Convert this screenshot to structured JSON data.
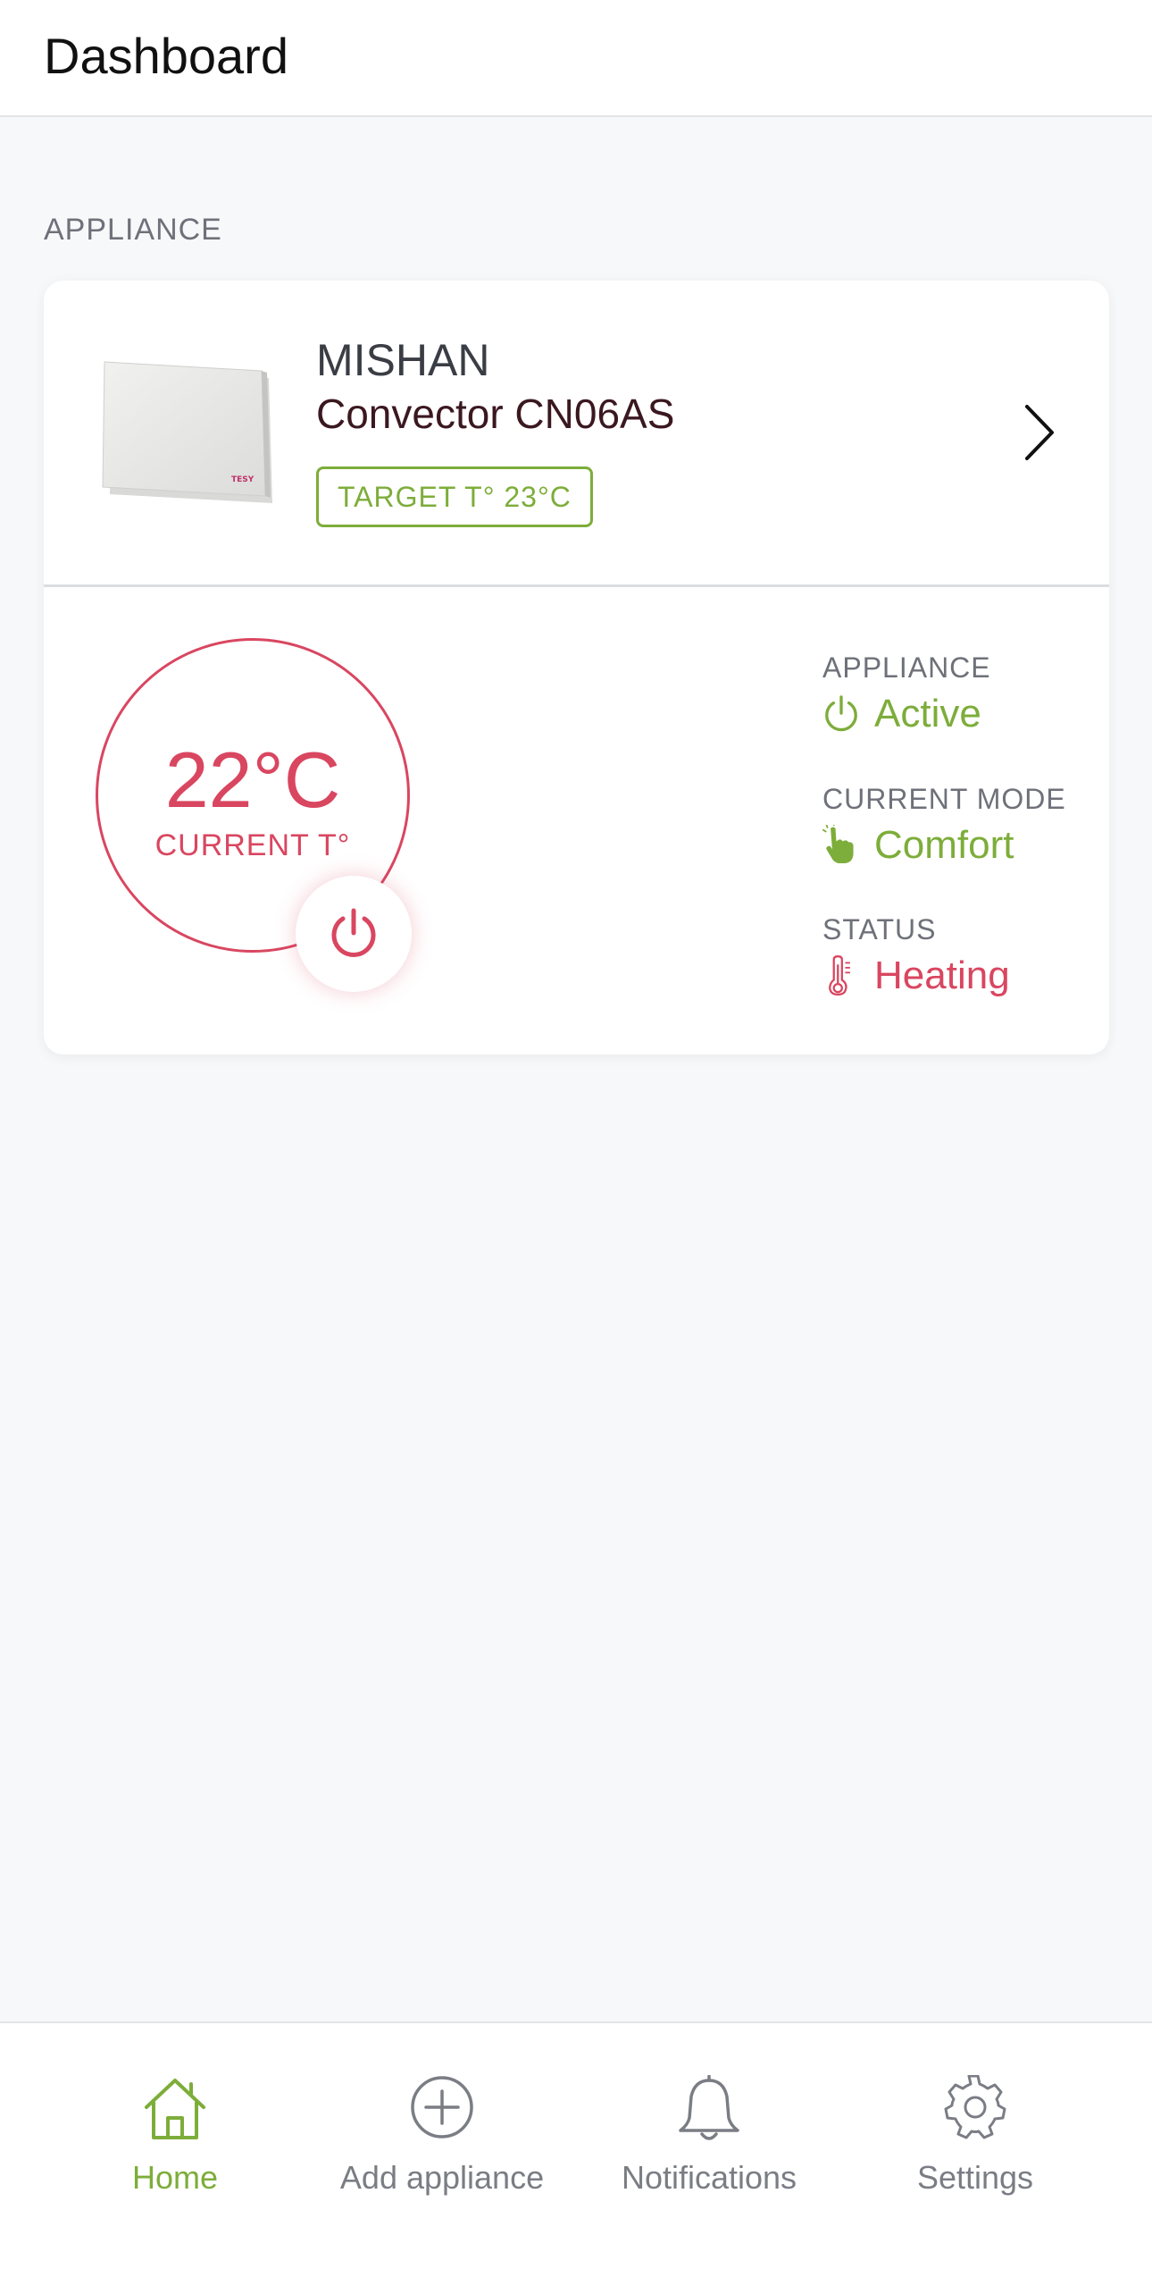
{
  "header": {
    "title": "Dashboard"
  },
  "section": {
    "label": "APPLIANCE"
  },
  "appliance": {
    "name": "MISHAN",
    "model": "Convector CN06AS",
    "target_label": "TARGET T° 23°C",
    "image_brand": "TESY",
    "current_temp": "22°C",
    "current_label": "CURRENT T°",
    "info": [
      {
        "label": "APPLIANCE",
        "value": "Active",
        "icon": "power-icon",
        "color": "#7dad3a"
      },
      {
        "label": "CURRENT MODE",
        "value": "Comfort",
        "icon": "hand-pointer-icon",
        "color": "#7dad3a"
      },
      {
        "label": "STATUS",
        "value": "Heating",
        "icon": "thermometer-icon",
        "color": "#d94660"
      }
    ]
  },
  "nav": {
    "items": [
      {
        "label": "Home",
        "icon": "home-icon",
        "active": true
      },
      {
        "label": "Add appliance",
        "icon": "plus-circle-icon",
        "active": false
      },
      {
        "label": "Notifications",
        "icon": "bell-icon",
        "active": false
      },
      {
        "label": "Settings",
        "icon": "gear-icon",
        "active": false
      }
    ]
  },
  "colors": {
    "accent_green": "#7dad3a",
    "accent_red": "#d94660",
    "background": "#f7f8fa"
  }
}
